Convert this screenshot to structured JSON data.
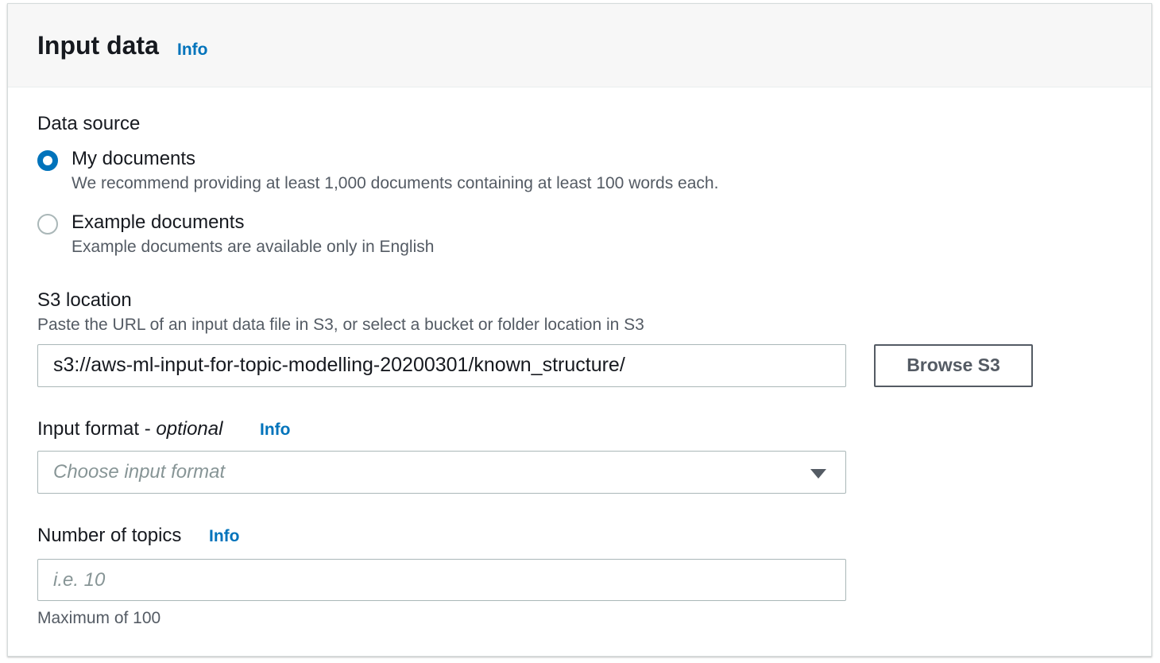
{
  "panel": {
    "title": "Input data",
    "info": "Info"
  },
  "data_source": {
    "label": "Data source",
    "options": [
      {
        "label": "My documents",
        "description": "We recommend providing at least 1,000 documents containing at least 100 words each.",
        "selected": true
      },
      {
        "label": "Example documents",
        "description": "Example documents are available only in English",
        "selected": false
      }
    ]
  },
  "s3_location": {
    "label": "S3 location",
    "description": "Paste the URL of an input data file in S3, or select a bucket or folder location in S3",
    "value": "s3://aws-ml-input-for-topic-modelling-20200301/known_structure/",
    "browse_label": "Browse S3"
  },
  "input_format": {
    "label": "Input format - ",
    "label_optional": "optional",
    "info": "Info",
    "placeholder": "Choose input format",
    "caret_icon": "caret-down-icon"
  },
  "number_of_topics": {
    "label": "Number of topics",
    "info": "Info",
    "placeholder": "i.e. 10",
    "hint": "Maximum of 100"
  },
  "colors": {
    "accent": "#0073bb",
    "header_bg": "#f7f7f7",
    "border": "#aab7b8",
    "secondary_text": "#545b64"
  }
}
